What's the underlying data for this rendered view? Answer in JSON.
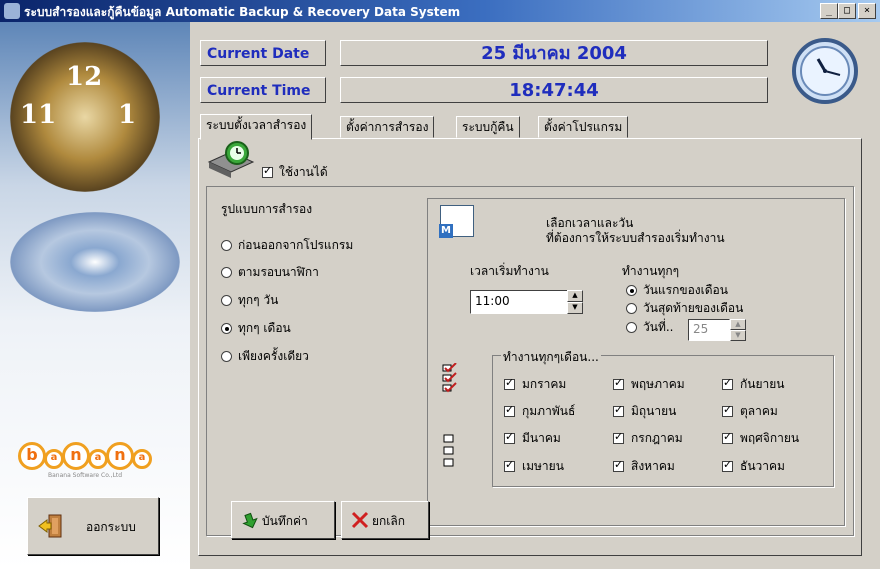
{
  "window": {
    "title": "ระบบสำรองและกู้คืนข้อมูล  Automatic Backup & Recovery Data System",
    "min_label": "_",
    "max_label": "□",
    "close_label": "×"
  },
  "sidebar": {
    "clock_numbers": [
      "12",
      "11",
      "1"
    ],
    "logo_letters": [
      "b",
      "a",
      "n",
      "a",
      "n",
      "a"
    ],
    "logo_subtitle": "Banana Software Co.,Ltd",
    "logout_label": "ออกระบบ"
  },
  "header": {
    "date_label": "Current Date",
    "date_value": "25 มีนาคม 2004",
    "time_label": "Current Time",
    "time_value": "18:47:44"
  },
  "tabs": [
    {
      "label": "ระบบตั้งเวลาสำรอง",
      "active": true
    },
    {
      "label": "ตั้งค่าการสำรอง",
      "active": false
    },
    {
      "label": "ระบบกู้คืน",
      "active": false
    },
    {
      "label": "ตั้งค่าโปรแกรม",
      "active": false
    }
  ],
  "enable": {
    "label": "ใช้งานได้",
    "checked": true
  },
  "backup_type": {
    "title": "รูปแบบการสำรอง",
    "options": [
      {
        "label": "ก่อนออกจากโปรแกรม",
        "selected": false
      },
      {
        "label": "ตามรอบนาฬิกา",
        "selected": false
      },
      {
        "label": "ทุกๆ วัน",
        "selected": false
      },
      {
        "label": "ทุกๆ เดือน",
        "selected": true
      },
      {
        "label": "เพียงครั้งเดียว",
        "selected": false
      }
    ]
  },
  "schedule": {
    "description_line1": "เลือกเวลาและวัน",
    "description_line2": "ที่ต้องการให้ระบบสำรองเริ่มทำงาน",
    "start_time_label": "เวลาเริ่มทำงาน",
    "start_time_value": "11:00",
    "every_label": "ทำงานทุกๆ",
    "every_options": [
      {
        "label": "วันแรกของเดือน",
        "selected": true
      },
      {
        "label": "วันสุดท้ายของเดือน",
        "selected": false
      },
      {
        "label": "วันที่..",
        "selected": false
      }
    ],
    "day_value": "25"
  },
  "months_group": {
    "title": "ทำงานทุกๆเดือน...",
    "months": [
      {
        "label": "มกราคม",
        "checked": true
      },
      {
        "label": "พฤษภาคม",
        "checked": true
      },
      {
        "label": "กันยายน",
        "checked": true
      },
      {
        "label": "กุมภาพันธ์",
        "checked": true
      },
      {
        "label": "มิถุนายน",
        "checked": true
      },
      {
        "label": "ตุลาคม",
        "checked": true
      },
      {
        "label": "มีนาคม",
        "checked": true
      },
      {
        "label": "กรกฎาคม",
        "checked": true
      },
      {
        "label": "พฤศจิกายน",
        "checked": true
      },
      {
        "label": "เมษายน",
        "checked": true
      },
      {
        "label": "สิงหาคม",
        "checked": true
      },
      {
        "label": "ธันวาคม",
        "checked": true
      }
    ]
  },
  "actions": {
    "save_label": "บันทึกค่า",
    "cancel_label": "ยกเลิก"
  }
}
